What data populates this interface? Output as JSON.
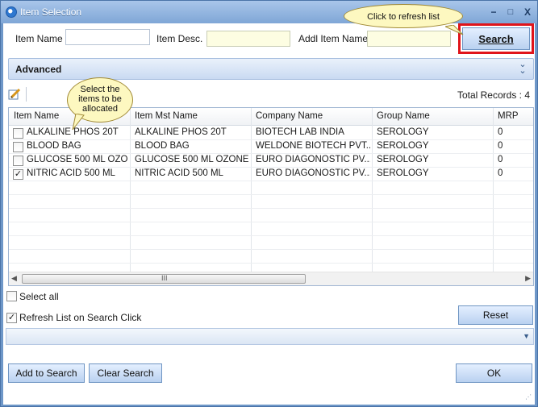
{
  "window": {
    "title": "Item Selection",
    "minimize_glyph": "−",
    "restore_glyph": "□",
    "close_glyph": "X"
  },
  "search": {
    "item_name_label": "Item Name",
    "item_name_value": "",
    "item_desc_label": "Item Desc.",
    "item_desc_value": "",
    "addl_item_name_label": "Addl Item Name",
    "addl_item_name_value": "",
    "search_button": "Search"
  },
  "callouts": {
    "refresh": "Click to refresh list",
    "select_items": "Select the items to be allocated"
  },
  "advanced": {
    "label": "Advanced",
    "chevron_icon": "double-chevron-down-icon"
  },
  "toolbar": {
    "edit_icon": "pencil-edit-icon",
    "total_records": "Total Records : 4"
  },
  "grid": {
    "columns": [
      "Item Name",
      "Item Mst Name",
      "Company Name",
      "Group Name",
      "MRP"
    ],
    "rows": [
      {
        "checked": false,
        "item_name": "ALKALINE PHOS 20T",
        "item_mst_name": "ALKALINE PHOS 20T",
        "company": "BIOTECH LAB INDIA",
        "group": "SEROLOGY",
        "mrp": "0"
      },
      {
        "checked": false,
        "item_name": "BLOOD BAG",
        "item_mst_name": "BLOOD BAG",
        "company": "WELDONE BIOTECH PVT...",
        "group": "SEROLOGY",
        "mrp": "0"
      },
      {
        "checked": false,
        "item_name": "GLUCOSE 500 ML OZO...",
        "item_mst_name": "GLUCOSE 500 ML OZONE",
        "company": "EURO DIAGONOSTIC PV...",
        "group": "SEROLOGY",
        "mrp": "0"
      },
      {
        "checked": true,
        "item_name": "NITRIC ACID 500 ML",
        "item_mst_name": "NITRIC ACID 500 ML",
        "company": "EURO DIAGONOSTIC PV...",
        "group": "SEROLOGY",
        "mrp": "0"
      }
    ],
    "scroll_grip": "III"
  },
  "options": {
    "select_all": "Select all",
    "select_all_checked": false,
    "refresh_on_search": "Refresh List on Search Click",
    "refresh_on_search_checked": true,
    "reset_button": "Reset"
  },
  "footer": {
    "add_to_search": "Add to Search",
    "clear_search": "Clear Search",
    "ok": "OK"
  },
  "colors": {
    "title_bar": "#7fa6d6",
    "highlight": "#e0141a",
    "callout": "#fdf8c0",
    "yellow_field": "#fdfde2"
  }
}
